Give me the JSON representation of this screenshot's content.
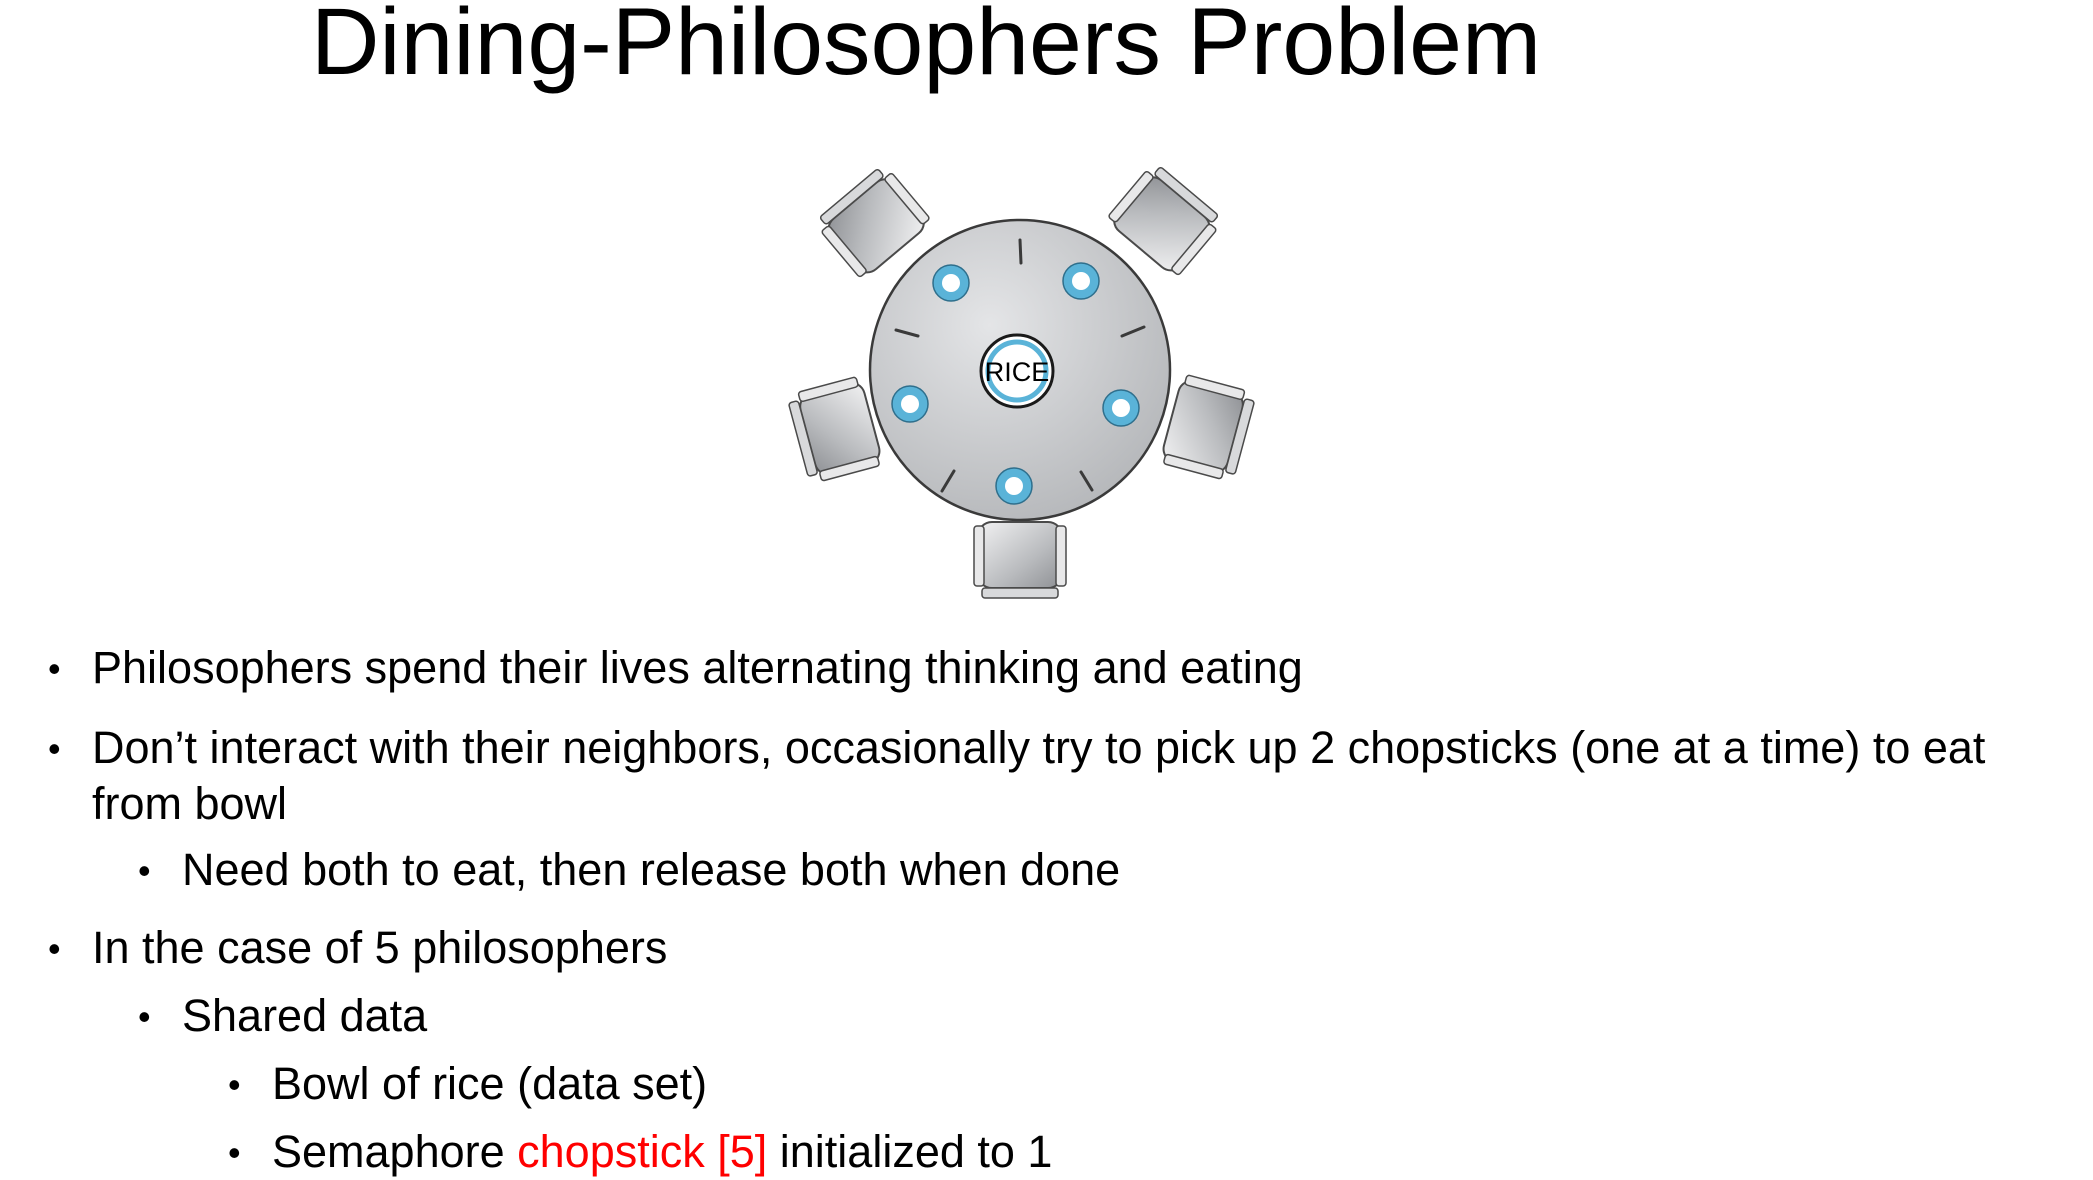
{
  "title": "Dining-Philosophers Problem",
  "diagram": {
    "center_label": "RICE",
    "colors": {
      "table": "#c8c9cb",
      "bowl_ring": "#5ab3d8",
      "chair": "#bfc1c4",
      "outline": "#3a3a3a"
    }
  },
  "bullets": [
    {
      "level": 1,
      "text": "Philosophers spend their lives alternating thinking and eating"
    },
    {
      "level": 1,
      "text": "Don’t interact with their neighbors, occasionally try to pick up 2 chopsticks (one at a time) to eat",
      "text2": "from bowl"
    },
    {
      "level": 2,
      "text": "Need both to eat, then release both when done"
    },
    {
      "level": 1,
      "text": "In the case of 5 philosophers"
    },
    {
      "level": 2,
      "text": "Shared data"
    },
    {
      "level": 3,
      "text": "Bowl of rice (data set)"
    },
    {
      "level": 3,
      "prefix": "Semaphore ",
      "highlight": "chopstick [5]",
      "suffix": " initialized to 1",
      "highlight_color": "#ff0000"
    }
  ],
  "bullet_glyph": "•"
}
